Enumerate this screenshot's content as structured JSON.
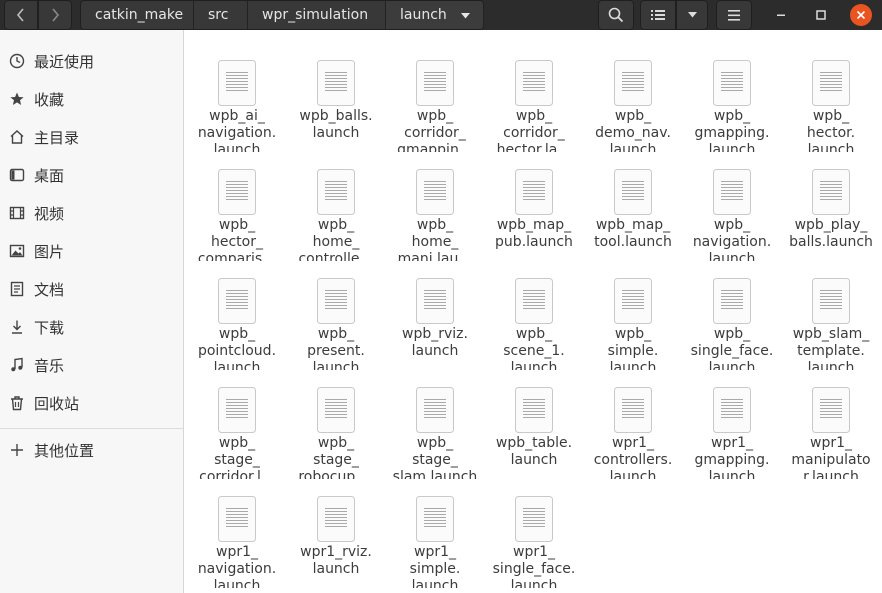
{
  "header": {
    "back_icon": "chevron-left-icon",
    "forward_icon": "chevron-right-icon",
    "breadcrumbs": [
      "catkin_make",
      "src",
      "wpr_simulation",
      "launch"
    ],
    "search_icon": "search-icon",
    "view_icon": "list-view-icon",
    "view_options_icon": "chevron-down-icon",
    "menu_icon": "hamburger-menu-icon",
    "minimize_icon": "minimize-icon",
    "maximize_icon": "maximize-icon",
    "close_icon": "close-icon",
    "close_color": "#e95420"
  },
  "sidebar": {
    "items": [
      {
        "label": "最近使用",
        "icon": "clock-icon"
      },
      {
        "label": "收藏",
        "icon": "star-icon"
      },
      {
        "label": "主目录",
        "icon": "home-icon"
      },
      {
        "label": "桌面",
        "icon": "desktop-icon"
      },
      {
        "label": "视频",
        "icon": "video-icon"
      },
      {
        "label": "图片",
        "icon": "picture-icon"
      },
      {
        "label": "文档",
        "icon": "document-icon"
      },
      {
        "label": "下载",
        "icon": "download-icon"
      },
      {
        "label": "音乐",
        "icon": "music-icon"
      },
      {
        "label": "回收站",
        "icon": "trash-icon"
      },
      {
        "label": "其他位置",
        "icon": "plus-icon"
      }
    ]
  },
  "files": [
    "wpb_ai_\nnavigation.\nlaunch",
    "wpb_balls.\nlaunch",
    "wpb_\ncorridor_\ngmappin…",
    "wpb_\ncorridor_\nhector.la…",
    "wpb_\ndemo_nav.\nlaunch",
    "wpb_\ngmapping.\nlaunch",
    "wpb_\nhector.\nlaunch",
    "wpb_\nhector_\ncomparis…",
    "wpb_\nhome_\ncontrolle…",
    "wpb_\nhome_\nmani.lau…",
    "wpb_map_\npub.launch",
    "wpb_map_\ntool.launch",
    "wpb_\nnavigation.\nlaunch",
    "wpb_play_\nballs.launch",
    "wpb_\npointcloud.\nlaunch",
    "wpb_\npresent.\nlaunch",
    "wpb_rviz.\nlaunch",
    "wpb_\nscene_1.\nlaunch",
    "wpb_\nsimple.\nlaunch",
    "wpb_\nsingle_face.\nlaunch",
    "wpb_slam_\ntemplate.\nlaunch",
    "wpb_\nstage_\ncorridor.l…",
    "wpb_\nstage_\nrobocup.…",
    "wpb_\nstage_\nslam.launch",
    "wpb_table.\nlaunch",
    "wpr1_\ncontrollers.\nlaunch",
    "wpr1_\ngmapping.\nlaunch",
    "wpr1_\nmanipulato\nr.launch",
    "wpr1_\nnavigation.\nlaunch",
    "wpr1_rviz.\nlaunch",
    "wpr1_\nsimple.\nlaunch",
    "wpr1_\nsingle_face.\nlaunch"
  ],
  "file_icon": "text-document-icon"
}
